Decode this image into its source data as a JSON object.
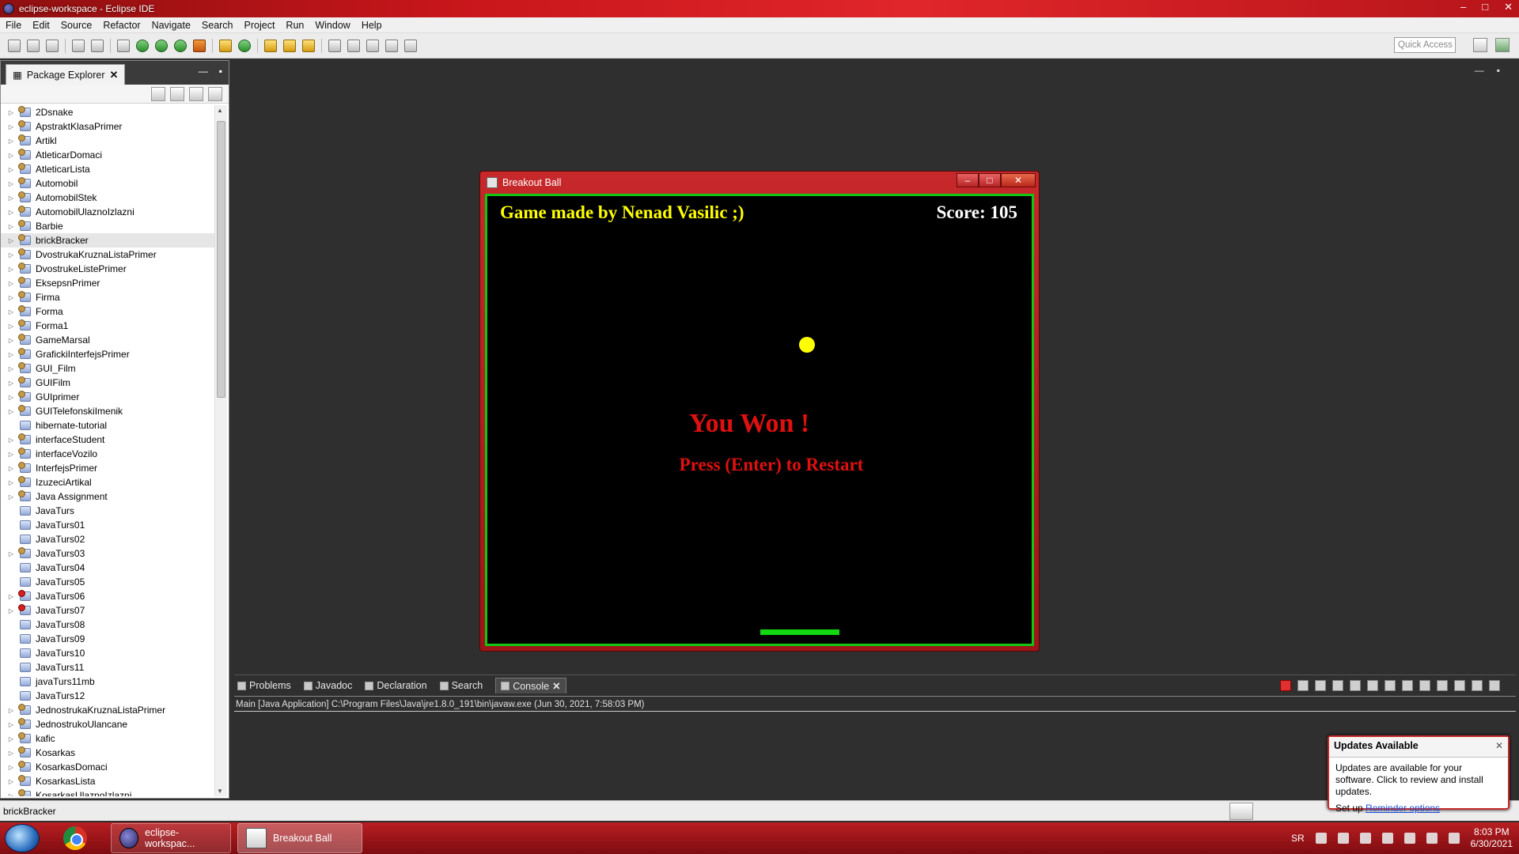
{
  "window": {
    "title": "eclipse-workspace - Eclipse IDE",
    "min": "–",
    "max": "□",
    "close": "✕"
  },
  "menu": [
    "File",
    "Edit",
    "Source",
    "Refactor",
    "Navigate",
    "Search",
    "Project",
    "Run",
    "Window",
    "Help"
  ],
  "toolbar": {
    "quick_access": "Quick Access"
  },
  "package_explorer": {
    "tab_label": "Package Explorer",
    "close": "✕",
    "minimize": "—",
    "maximize": "▪",
    "projects": [
      {
        "name": "2Dsnake",
        "expandable": true,
        "icon": "java-project-icon"
      },
      {
        "name": "ApstraktKlasaPrimer",
        "expandable": true,
        "icon": "java-project-icon"
      },
      {
        "name": "Artikl",
        "expandable": true,
        "icon": "java-project-icon"
      },
      {
        "name": "AtleticarDomaci",
        "expandable": true,
        "icon": "java-project-icon"
      },
      {
        "name": "AtleticarLista",
        "expandable": true,
        "icon": "java-project-icon"
      },
      {
        "name": "Automobil",
        "expandable": true,
        "icon": "java-project-icon"
      },
      {
        "name": "AutomobilStek",
        "expandable": true,
        "icon": "java-project-icon"
      },
      {
        "name": "AutomobilUlaznoIzlazni",
        "expandable": true,
        "icon": "java-project-icon"
      },
      {
        "name": "Barbie",
        "expandable": true,
        "icon": "java-project-icon"
      },
      {
        "name": "brickBracker",
        "expandable": true,
        "icon": "java-project-icon",
        "selected": true
      },
      {
        "name": "DvostrukaKruznaListaPrimer",
        "expandable": true,
        "icon": "java-project-icon"
      },
      {
        "name": "DvostrukeListePrimer",
        "expandable": true,
        "icon": "java-project-icon"
      },
      {
        "name": "EksepsnPrimer",
        "expandable": true,
        "icon": "java-project-icon"
      },
      {
        "name": "Firma",
        "expandable": true,
        "icon": "java-project-icon"
      },
      {
        "name": "Forma",
        "expandable": true,
        "icon": "java-project-icon"
      },
      {
        "name": "Forma1",
        "expandable": true,
        "icon": "java-project-icon"
      },
      {
        "name": "GameMarsal",
        "expandable": true,
        "icon": "java-project-icon"
      },
      {
        "name": "GrafickiInterfejsPrimer",
        "expandable": true,
        "icon": "java-project-icon"
      },
      {
        "name": "GUI_Film",
        "expandable": true,
        "icon": "java-project-icon"
      },
      {
        "name": "GUIFilm",
        "expandable": true,
        "icon": "java-project-icon"
      },
      {
        "name": "GUIprimer",
        "expandable": true,
        "icon": "java-project-icon"
      },
      {
        "name": "GUITelefonskiImenik",
        "expandable": true,
        "icon": "java-project-icon"
      },
      {
        "name": "hibernate-tutorial",
        "expandable": false,
        "icon": "folder-project-icon"
      },
      {
        "name": "interfaceStudent",
        "expandable": true,
        "icon": "java-project-icon"
      },
      {
        "name": "interfaceVozilo",
        "expandable": true,
        "icon": "java-project-icon"
      },
      {
        "name": "InterfejsPrimer",
        "expandable": true,
        "icon": "java-project-icon"
      },
      {
        "name": "IzuzeciArtikal",
        "expandable": true,
        "icon": "java-project-icon"
      },
      {
        "name": "Java Assignment",
        "expandable": true,
        "icon": "java-project-icon"
      },
      {
        "name": "JavaTurs",
        "expandable": false,
        "icon": "folder-project-icon"
      },
      {
        "name": "JavaTurs01",
        "expandable": false,
        "icon": "folder-project-icon"
      },
      {
        "name": "JavaTurs02",
        "expandable": false,
        "icon": "folder-project-icon"
      },
      {
        "name": "JavaTurs03",
        "expandable": true,
        "icon": "java-project-icon"
      },
      {
        "name": "JavaTurs04",
        "expandable": false,
        "icon": "folder-project-icon"
      },
      {
        "name": "JavaTurs05",
        "expandable": false,
        "icon": "folder-project-icon"
      },
      {
        "name": "JavaTurs06",
        "expandable": true,
        "icon": "error-project-icon"
      },
      {
        "name": "JavaTurs07",
        "expandable": true,
        "icon": "error-project-icon"
      },
      {
        "name": "JavaTurs08",
        "expandable": false,
        "icon": "folder-project-icon"
      },
      {
        "name": "JavaTurs09",
        "expandable": false,
        "icon": "folder-project-icon"
      },
      {
        "name": "JavaTurs10",
        "expandable": false,
        "icon": "folder-project-icon"
      },
      {
        "name": "JavaTurs11",
        "expandable": false,
        "icon": "folder-project-icon"
      },
      {
        "name": "javaTurs11mb",
        "expandable": false,
        "icon": "folder-project-icon"
      },
      {
        "name": "JavaTurs12",
        "expandable": false,
        "icon": "folder-project-icon"
      },
      {
        "name": "JednostrukaKruznaListaPrimer",
        "expandable": true,
        "icon": "java-project-icon"
      },
      {
        "name": "JednostrukoUlancane",
        "expandable": true,
        "icon": "java-project-icon"
      },
      {
        "name": "kafic",
        "expandable": true,
        "icon": "java-project-icon"
      },
      {
        "name": "Kosarkas",
        "expandable": true,
        "icon": "java-project-icon"
      },
      {
        "name": "KosarkasDomaci",
        "expandable": true,
        "icon": "java-project-icon"
      },
      {
        "name": "KosarkasLista",
        "expandable": true,
        "icon": "java-project-icon"
      },
      {
        "name": "KosarkasUlaznoIzlazni",
        "expandable": true,
        "icon": "java-project-icon"
      }
    ]
  },
  "editor": {
    "minimize": "—",
    "maximize": "▪"
  },
  "console": {
    "tabs": [
      "Problems",
      "Javadoc",
      "Declaration",
      "Search",
      "Console"
    ],
    "active_tab": "Console",
    "close": "✕",
    "launch_line": "Main [Java Application] C:\\Program Files\\Java\\jre1.8.0_191\\bin\\javaw.exe (Jun 30, 2021, 7:58:03 PM)"
  },
  "status_bar": {
    "selection": "brickBracker"
  },
  "game": {
    "title": "Breakout Ball",
    "min": "–",
    "max": "□",
    "close": "✕",
    "credit": "Game made by Nenad Vasilic ;)",
    "score": "Score: 105",
    "message": "You Won !",
    "restart": "Press (Enter) to Restart",
    "colors": {
      "background": "#000000",
      "border": "#12c612",
      "ball": "#ffff00",
      "paddle": "#12d812",
      "text": "#e01010"
    }
  },
  "updates_popup": {
    "title": "Updates Available",
    "close": "✕",
    "body": "Updates are available for your software. Click to review and install updates.",
    "setup_prefix": "Set up",
    "setup_link": "Reminder options"
  },
  "taskbar": {
    "items": [
      {
        "label": "eclipse-workspac...",
        "icon": "eclipse-icon"
      },
      {
        "label": "Breakout Ball",
        "icon": "java-window-icon"
      }
    ],
    "language": "SR",
    "time": "8:03 PM",
    "date": "6/30/2021"
  }
}
